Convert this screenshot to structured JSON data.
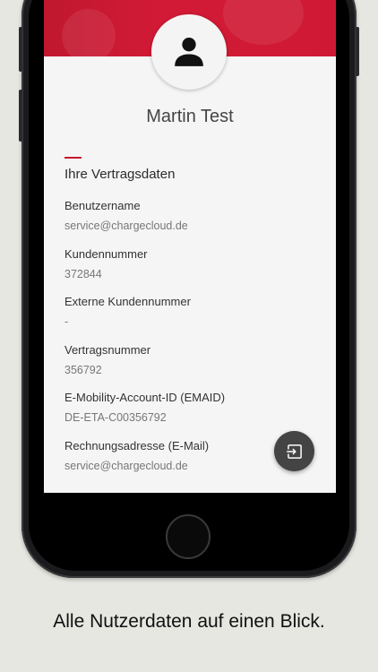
{
  "profile": {
    "name": "Martin Test",
    "avatar_icon": "person-icon"
  },
  "contract": {
    "section_title": "Ihre Vertragsdaten",
    "fields": [
      {
        "label": "Benutzername",
        "value": "service@chargecloud.de"
      },
      {
        "label": "Kundennummer",
        "value": "372844"
      },
      {
        "label": "Externe Kundennummer",
        "value": "-"
      },
      {
        "label": "Vertragsnummer",
        "value": "356792"
      },
      {
        "label": "E-Mobility-Account-ID (EMAID)",
        "value": "DE-ETA-C00356792"
      },
      {
        "label": "Rechnungsadresse (E-Mail)",
        "value": "service@chargecloud.de"
      }
    ]
  },
  "actions": {
    "logout_icon": "logout-icon"
  },
  "caption": "Alle Nutzerdaten auf einen Blick.",
  "colors": {
    "accent": "#c8172f",
    "background": "#e6e7e1",
    "fab": "#444444"
  }
}
